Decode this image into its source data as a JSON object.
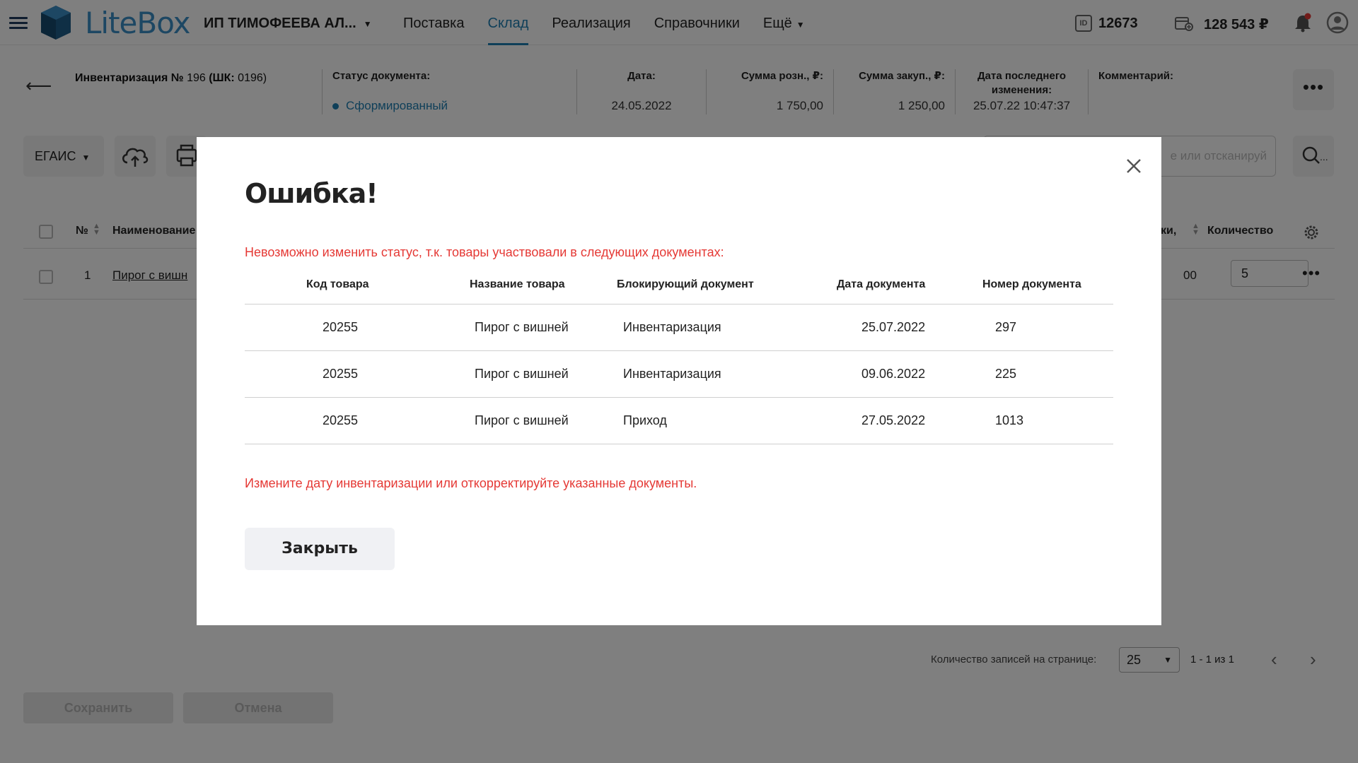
{
  "app": {
    "logo_text": "LiteBox",
    "org_name": "ИП ТИМОФЕЕВА АЛ...",
    "nav": [
      {
        "label": "Поставка"
      },
      {
        "label": "Склад"
      },
      {
        "label": "Реализация"
      },
      {
        "label": "Справочники"
      },
      {
        "label": "Ещё"
      }
    ],
    "active_nav": "Склад",
    "id_badge": "ID",
    "user_id": "12673",
    "balance": "128 543 ₽",
    "colors": {
      "accent": "#1e7fb3",
      "error": "#e53935",
      "notification": "#e53935"
    }
  },
  "doc": {
    "title_bold": "Инвентаризация №",
    "title_num": " 196 ",
    "title_sk_bold": "(ШК:",
    "title_sk_val": " 0196)",
    "status_label": "Статус документа:",
    "status_value": "Сформированный",
    "date_label": "Дата:",
    "date_value": "24.05.2022",
    "retail_label": "Сумма розн., ₽:",
    "retail_value": "1 750,00",
    "purchase_label": "Сумма закуп., ₽:",
    "purchase_value": "1 250,00",
    "modified_label_1": "Дата последнего",
    "modified_label_2": "изменения:",
    "modified_value": "25.07.22 10:47:37",
    "comment_label": "Комментарий:"
  },
  "toolbar": {
    "egais_label": "ЕГАИС",
    "search_placeholder": "е или отсканируй",
    "search_btn_suffix": "..."
  },
  "table": {
    "col_num": "№",
    "col_name": "Наименование",
    "col_partial": "ки,",
    "col_qty": "Количество",
    "rows": [
      {
        "num": "1",
        "name": "Пирог с вишн",
        "partial": "00",
        "qty": "5"
      }
    ]
  },
  "pager": {
    "label": "Количество записей на странице:",
    "per_page": "25",
    "range": "1 - 1 из 1"
  },
  "footer": {
    "save_label": "Сохранить",
    "cancel_label": "Отмена"
  },
  "modal": {
    "title": "Ошибка!",
    "message_top": "Невозможно изменить статус, т.к. товары участвовали в следующих документах:",
    "headers": [
      "Код товара",
      "Название товара",
      "Блокирующий документ",
      "Дата документа",
      "Номер документа"
    ],
    "rows": [
      {
        "code": "20255",
        "name": "Пирог с вишней",
        "doc": "Инвентаризация",
        "date": "25.07.2022",
        "number": "297"
      },
      {
        "code": "20255",
        "name": "Пирог с вишней",
        "doc": "Инвентаризация",
        "date": "09.06.2022",
        "number": "225"
      },
      {
        "code": "20255",
        "name": "Пирог с вишней",
        "doc": "Приход",
        "date": "27.05.2022",
        "number": "1013"
      }
    ],
    "message_bottom": "Измените дату инвентаризации или откорректируйте указанные документы.",
    "close_label": "Закрыть"
  }
}
